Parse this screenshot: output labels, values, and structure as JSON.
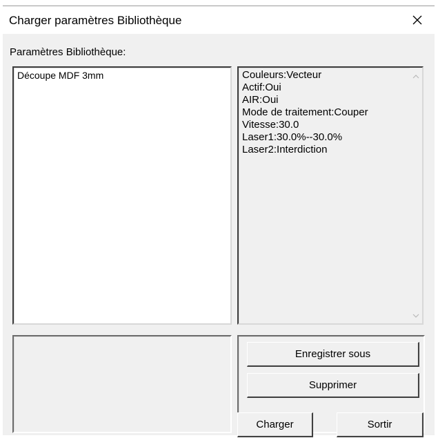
{
  "window": {
    "title": "Charger paramètres Bibliothèque",
    "close_glyph": "close-icon"
  },
  "library": {
    "section_label": "Paramètres Bibliothèque:",
    "items": [
      {
        "label": "Découpe MDF 3mm"
      }
    ]
  },
  "params": {
    "lines": [
      "Couleurs:Vecteur",
      "Actif:Oui",
      "AIR:Oui",
      "Mode de traitement:Couper",
      "Vitesse:30.0",
      "Laser1:30.0%--30.0%",
      "Laser2:Interdiction"
    ]
  },
  "buttons": {
    "save_as": "Enregistrer sous",
    "delete": "Supprimer",
    "load": "Charger",
    "exit": "Sortir"
  },
  "colors": {
    "window_bg": "#f0f0f0",
    "titlebar_bg": "#ffffff",
    "list_bg": "#ffffff"
  }
}
